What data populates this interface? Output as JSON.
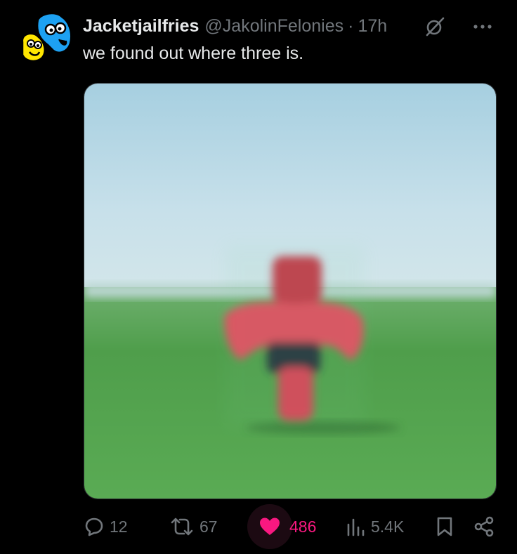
{
  "post": {
    "display_name": "Jacketjailfries",
    "handle": "@JakolinFelonies",
    "separator": "·",
    "time": "17h",
    "text": "we found out where three is."
  },
  "icons": {
    "avatar": "avatar-cartoon-face",
    "grok": "grok-icon",
    "more": "more-horizontal-icon",
    "reply": "reply-bubble-icon",
    "repost": "repost-icon",
    "like": "heart-icon",
    "views": "views-bars-icon",
    "bookmark": "bookmark-icon",
    "share": "share-icon"
  },
  "actions": {
    "replies": "12",
    "reposts": "67",
    "likes": "486",
    "views": "5.4K"
  },
  "colors": {
    "background": "#000000",
    "text_primary": "#e7e9ea",
    "text_secondary": "#71767b",
    "like_active": "#f91880"
  }
}
